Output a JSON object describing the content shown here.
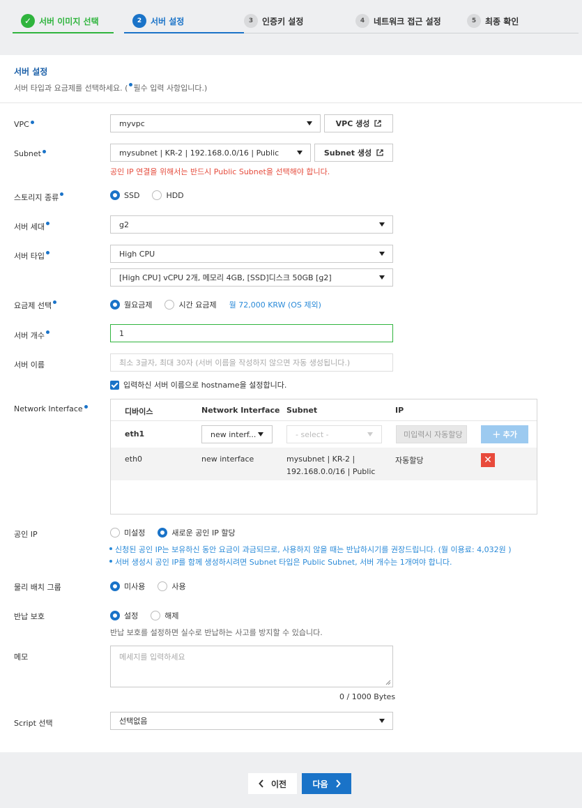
{
  "stepper": {
    "steps": [
      {
        "num": "✓",
        "label": "서버 이미지 선택",
        "state": "done"
      },
      {
        "num": "2",
        "label": "서버 설정",
        "state": "active"
      },
      {
        "num": "3",
        "label": "인증키 설정",
        "state": "todo"
      },
      {
        "num": "4",
        "label": "네트워크 접근 설정",
        "state": "todo"
      },
      {
        "num": "5",
        "label": "최종 확인",
        "state": "todo"
      }
    ]
  },
  "section": {
    "title": "서버 설정",
    "subtitle_prefix": "서버 타입과 요금제를 선택하세요. (",
    "subtitle_suffix": "필수 입력 사항입니다.)"
  },
  "form": {
    "vpc": {
      "label": "VPC",
      "value": "myvpc",
      "create_label": "VPC 생성"
    },
    "subnet": {
      "label": "Subnet",
      "value": "mysubnet | KR-2 | 192.168.0.0/16 | Public",
      "create_label": "Subnet 생성",
      "warning": "공인 IP 연결을 위해서는 반드시 Public Subnet을 선택해야 합니다."
    },
    "storage": {
      "label": "스토리지 종류",
      "options": [
        "SSD",
        "HDD"
      ],
      "selected": "SSD"
    },
    "generation": {
      "label": "서버 세대",
      "value": "g2"
    },
    "server_type": {
      "label": "서버 타입",
      "value": "High CPU",
      "spec": "[High CPU] vCPU 2개, 메모리 4GB, [SSD]디스크 50GB [g2]"
    },
    "billing": {
      "label": "요금제 선택",
      "options": [
        "월요금제",
        "시간 요금제"
      ],
      "selected": "월요금제",
      "price": "월 72,000 KRW (OS 제외)"
    },
    "count": {
      "label": "서버 개수",
      "value": "1"
    },
    "name": {
      "label": "서버 이름",
      "placeholder": "최소 3글자, 최대 30자 (서버 이름을 작성하지 않으면 자동 생성됩니다.)",
      "hostname_check": "입력하신 서버 이름으로 hostname을 설정합니다."
    },
    "network_interface": {
      "label": "Network Interface",
      "headers": [
        "디바이스",
        "Network Interface",
        "Subnet",
        "IP"
      ],
      "new_row": {
        "device": "eth1",
        "interface": "new interf...",
        "subnet_placeholder": "- select -",
        "ip_placeholder": "미입력시 자동할당",
        "add_label": "추가"
      },
      "rows": [
        {
          "device": "eth0",
          "interface": "new interface",
          "subnet_line1": "mysubnet | KR-2 |",
          "subnet_line2": "192.168.0.0/16 | Public",
          "ip": "자동할당"
        }
      ]
    },
    "public_ip": {
      "label": "공인 IP",
      "options": [
        "미설정",
        "새로운 공인 IP 할당"
      ],
      "selected": "새로운 공인 IP 할당",
      "notes": [
        "신청된 공인 IP는 보유하신 동안 요금이 과금되므로, 사용하지 않을 때는 반납하시기를 권장드립니다. (월 이용료: 4,032원 )",
        "서버 생성시 공인 IP를 함께 생성하시려면 Subnet 타입은 Public Subnet, 서버 개수는 1개여야 합니다."
      ]
    },
    "placement_group": {
      "label": "물리 배치 그룹",
      "options": [
        "미사용",
        "사용"
      ],
      "selected": "미사용"
    },
    "return_protection": {
      "label": "반납 보호",
      "options": [
        "설정",
        "해제"
      ],
      "selected": "설정",
      "hint": "반납 보호를 설정하면 실수로 반납하는 사고를 방지할 수 있습니다."
    },
    "memo": {
      "label": "메모",
      "placeholder": "메세지를 입력하세요",
      "counter": "0 / 1000 Bytes"
    },
    "script": {
      "label": "Script 선택",
      "value": "선택없음"
    }
  },
  "footer": {
    "prev_label": "이전",
    "next_label": "다음"
  },
  "colors": {
    "accent": "#1a73c8",
    "done": "#2fb43d",
    "error": "#e54b3c",
    "info": "#2a8ad8"
  }
}
